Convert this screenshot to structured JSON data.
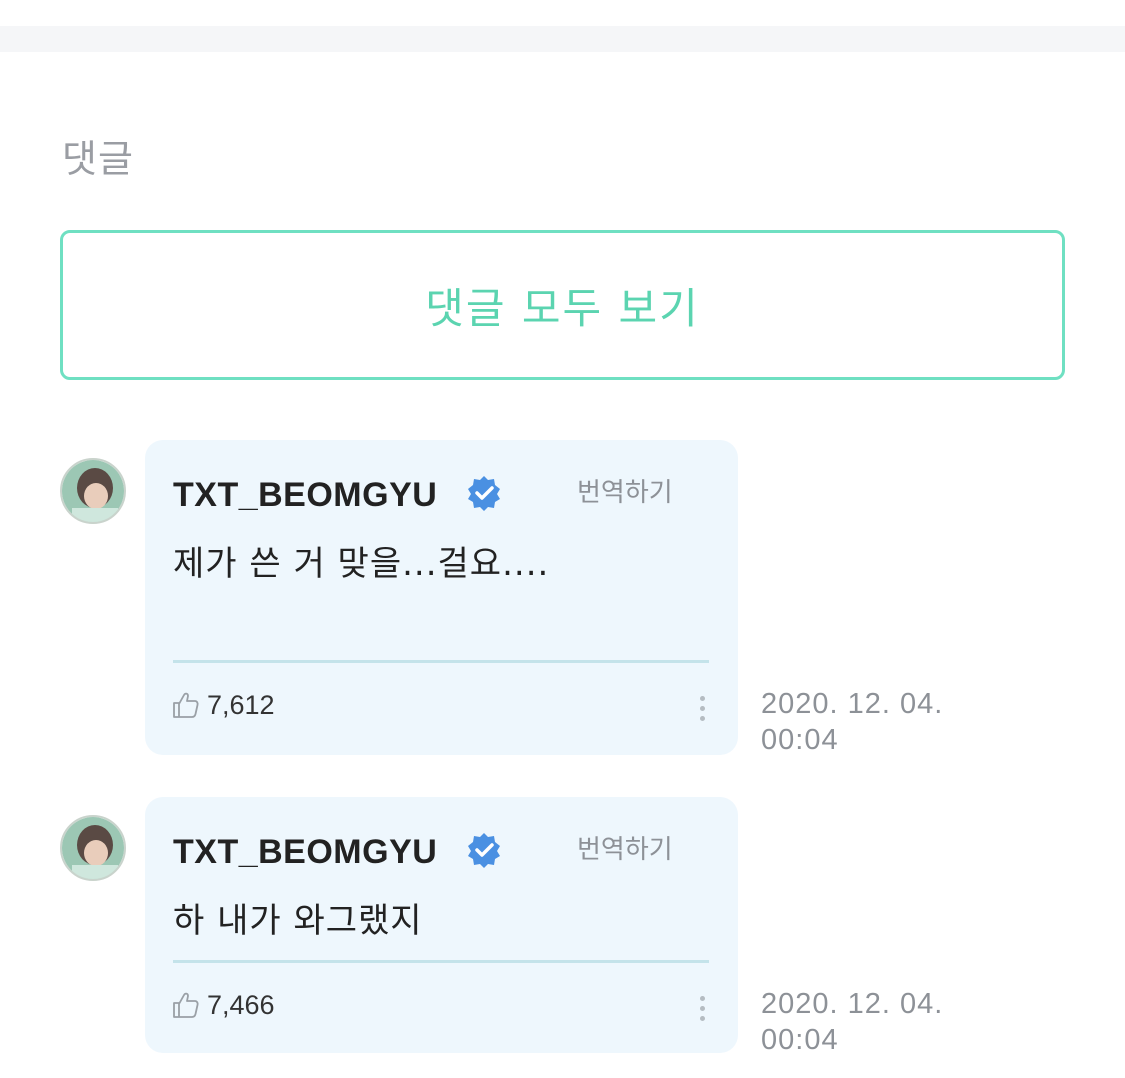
{
  "section": {
    "title": "댓글",
    "view_all_label": "댓글 모두 보기"
  },
  "comments": [
    {
      "author": "TXT_BEOMGYU",
      "verified_icon": "verified-badge-icon",
      "translate_label": "번역하기",
      "text": "제가 쓴 거 맞을...걸요....",
      "likes": "7,612",
      "date_line1": "2020. 12. 04.",
      "date_line2": "00:04"
    },
    {
      "author": "TXT_BEOMGYU",
      "verified_icon": "verified-badge-icon",
      "translate_label": "번역하기",
      "text": "하 내가 와그랬지",
      "likes": "7,466",
      "date_line1": "2020. 12. 04.",
      "date_line2": "00:04"
    }
  ],
  "colors": {
    "accent": "#5bd4b0",
    "bubble_bg": "#eef7fd",
    "verified_blue": "#4a90e2"
  }
}
